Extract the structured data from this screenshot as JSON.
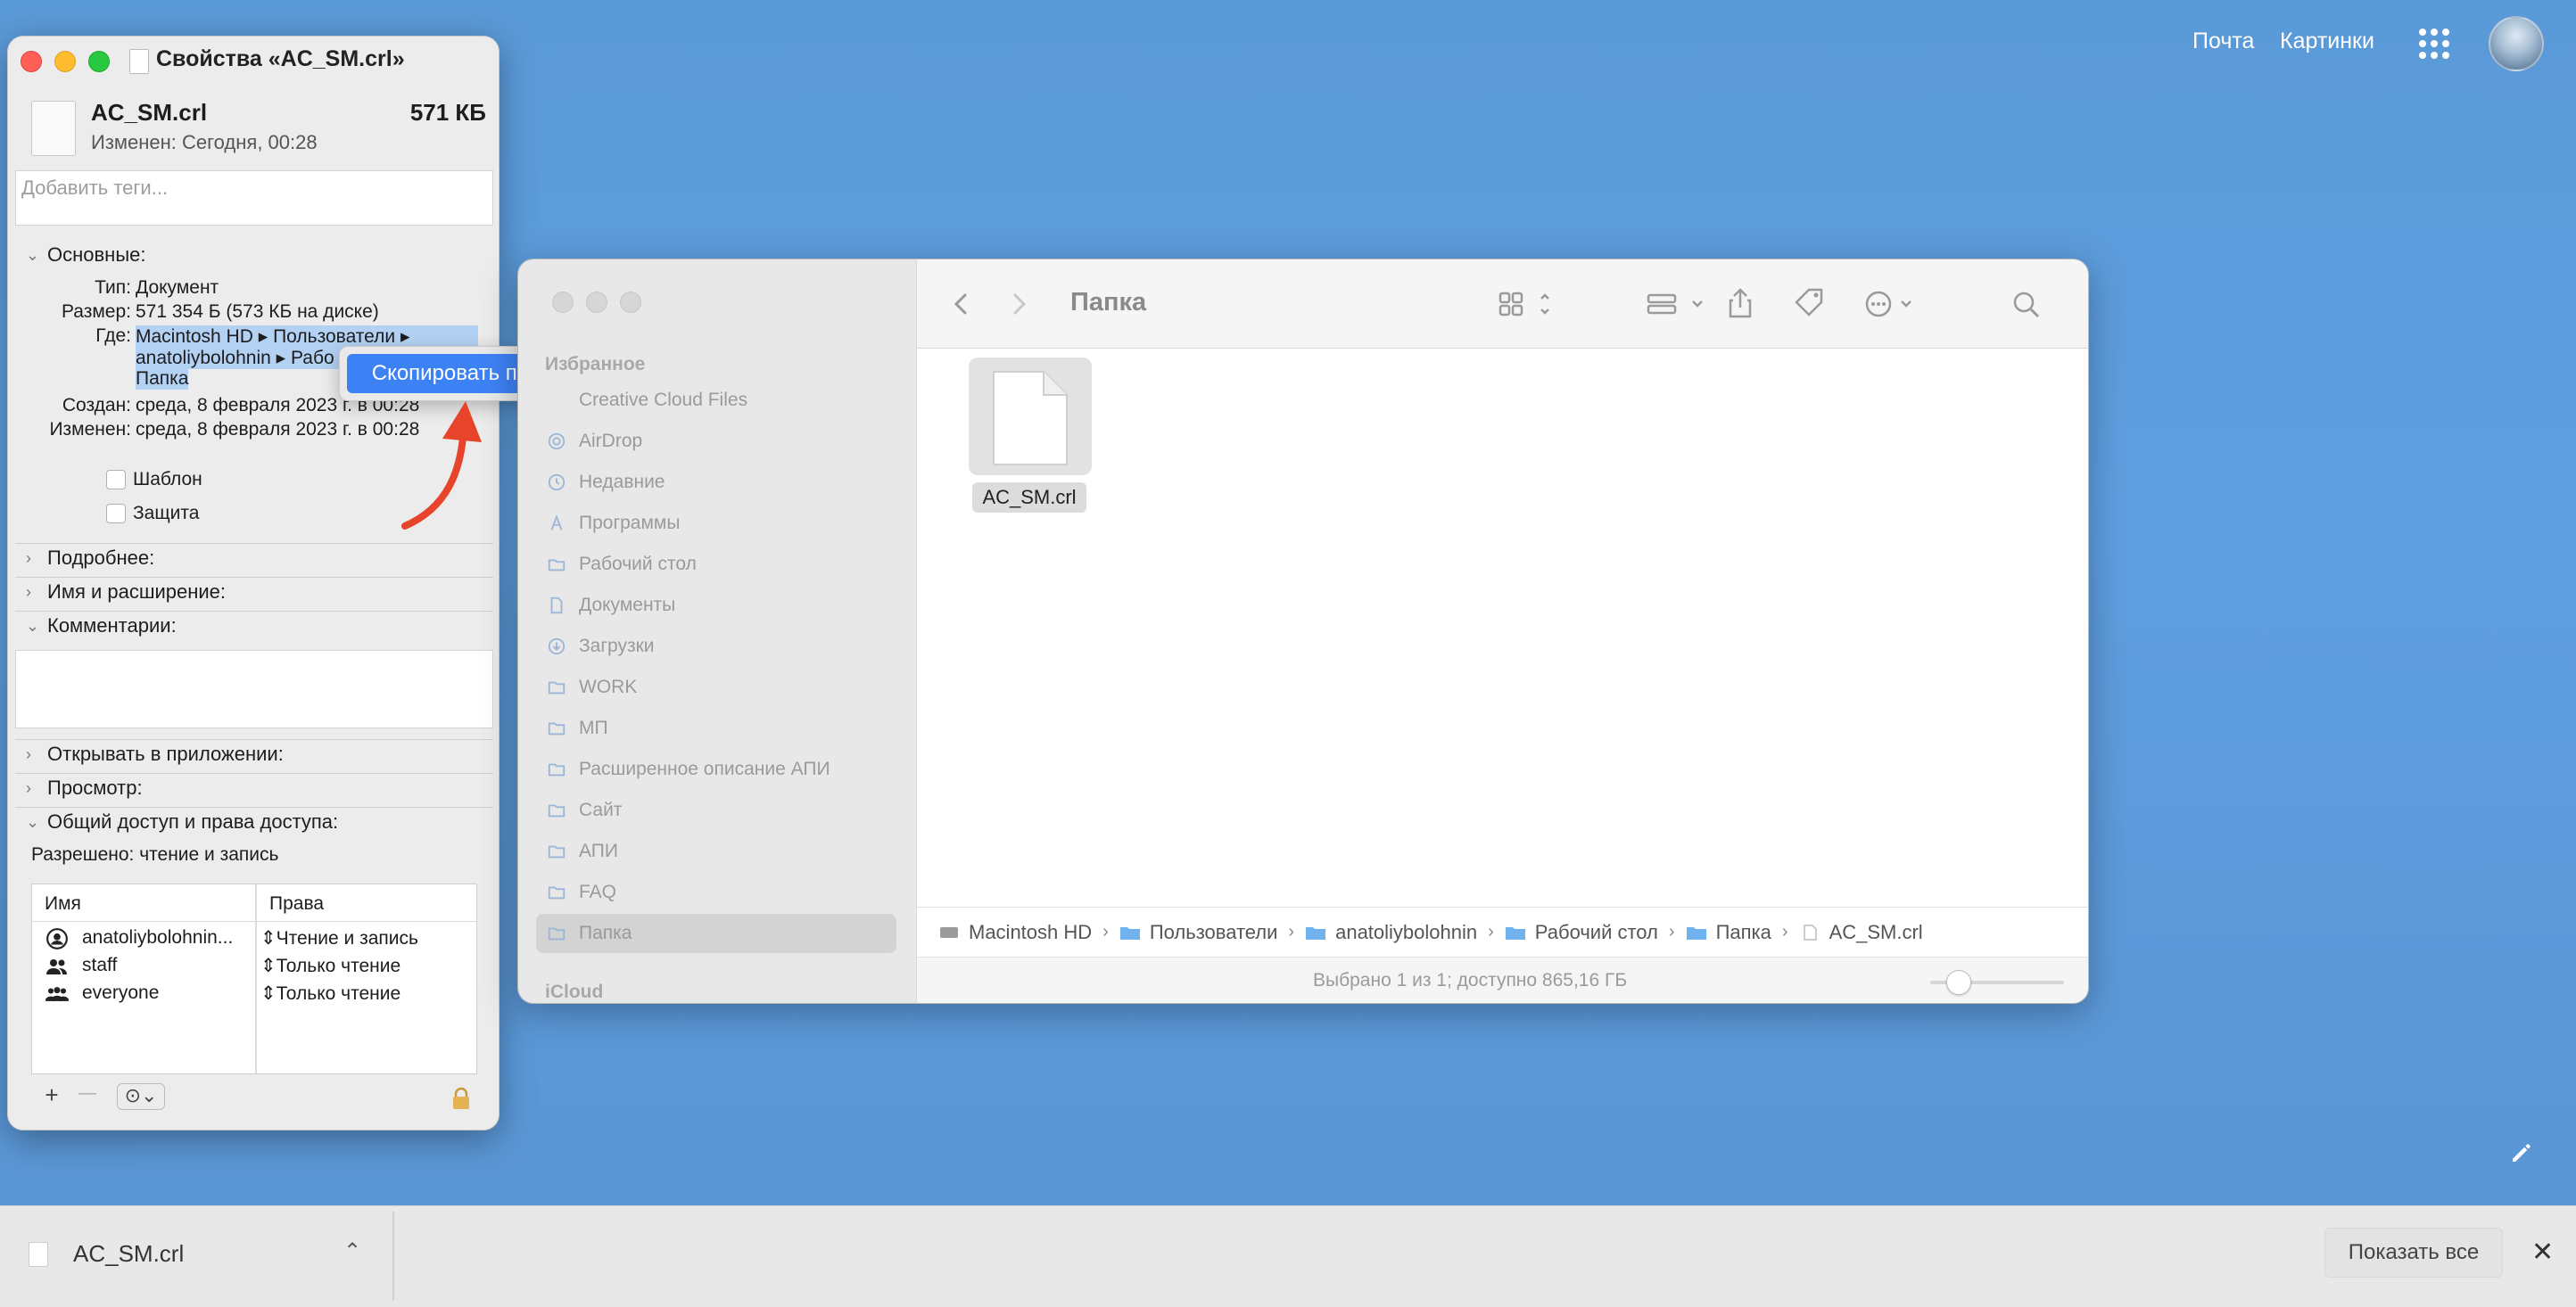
{
  "browser": {
    "mail_link": "Почта",
    "images_link": "Картинки"
  },
  "info_window": {
    "title": "Свойства «AC_SM.crl»",
    "file_name": "AC_SM.crl",
    "file_size": "571 КБ",
    "modified": "Изменен: Сегодня, 00:28",
    "tags_placeholder": "Добавить теги...",
    "general": {
      "header": "Основные:",
      "type_label": "Тип:",
      "type_value": "Документ",
      "size_label": "Размер:",
      "size_value": "571 354 Б (573 КБ на диске)",
      "where_label": "Где:",
      "where_line1": "Macintosh HD ▸ Пользователи ▸",
      "where_line2": "anatoliybolohnin ▸ Рабо",
      "where_line3": "Папка",
      "created_label": "Создан:",
      "created_value": "среда, 8 февраля 2023 г. в 00:28",
      "changed_label": "Изменен:",
      "changed_value": "среда, 8 февраля 2023 г. в 00:28",
      "template_label": "Шаблон",
      "locked_label": "Защита"
    },
    "sections": {
      "more_info": "Подробнее:",
      "name_ext": "Имя и расширение:",
      "comments": "Комментарии:",
      "open_with": "Открывать в приложении:",
      "preview": "Просмотр:",
      "sharing": "Общий доступ и права доступа:"
    },
    "sharing": {
      "allowed": "Разрешено: чтение и запись",
      "col_name": "Имя",
      "col_rights": "Права",
      "rows": [
        {
          "name": "anatoliybolohnin...",
          "rights": "Чтение и запись"
        },
        {
          "name": "staff",
          "rights": "Только чтение"
        },
        {
          "name": "everyone",
          "rights": "Только чтение"
        }
      ],
      "add_btn": "+",
      "remove_btn": "—",
      "action_btn": "⊙⌄"
    }
  },
  "context_menu": {
    "copy_path": "Скопировать путь"
  },
  "finder": {
    "title": "Папка",
    "sidebar": {
      "favorites_header": "Избранное",
      "items": [
        {
          "label": "Creative Cloud Files",
          "icon": "cloud-icon"
        },
        {
          "label": "AirDrop",
          "icon": "airdrop-icon"
        },
        {
          "label": "Недавние",
          "icon": "clock-icon"
        },
        {
          "label": "Программы",
          "icon": "apps-icon"
        },
        {
          "label": "Рабочий стол",
          "icon": "desktop-icon"
        },
        {
          "label": "Документы",
          "icon": "document-icon"
        },
        {
          "label": "Загрузки",
          "icon": "download-icon"
        },
        {
          "label": "WORK",
          "icon": "folder-icon"
        },
        {
          "label": "МП",
          "icon": "folder-icon"
        },
        {
          "label": "Расширенное описание АПИ",
          "icon": "folder-icon"
        },
        {
          "label": "Сайт",
          "icon": "folder-icon"
        },
        {
          "label": "АПИ",
          "icon": "folder-icon"
        },
        {
          "label": "FAQ",
          "icon": "folder-icon"
        },
        {
          "label": "Папка",
          "icon": "folder-icon"
        }
      ],
      "icloud_header": "iCloud"
    },
    "file": {
      "name": "AC_SM.crl"
    },
    "path": [
      "Macintosh HD",
      "Пользователи",
      "anatoliybolohnin",
      "Рабочий стол",
      "Папка",
      "AC_SM.crl"
    ],
    "status": "Выбрано 1 из 1; доступно 865,16 ГБ"
  },
  "download_bar": {
    "file_name": "AC_SM.crl",
    "show_all": "Показать все",
    "close": "✕"
  },
  "colors": {
    "desktop": "#5e9ee0",
    "accent": "#3d82f5",
    "arrow": "#e8432b"
  }
}
